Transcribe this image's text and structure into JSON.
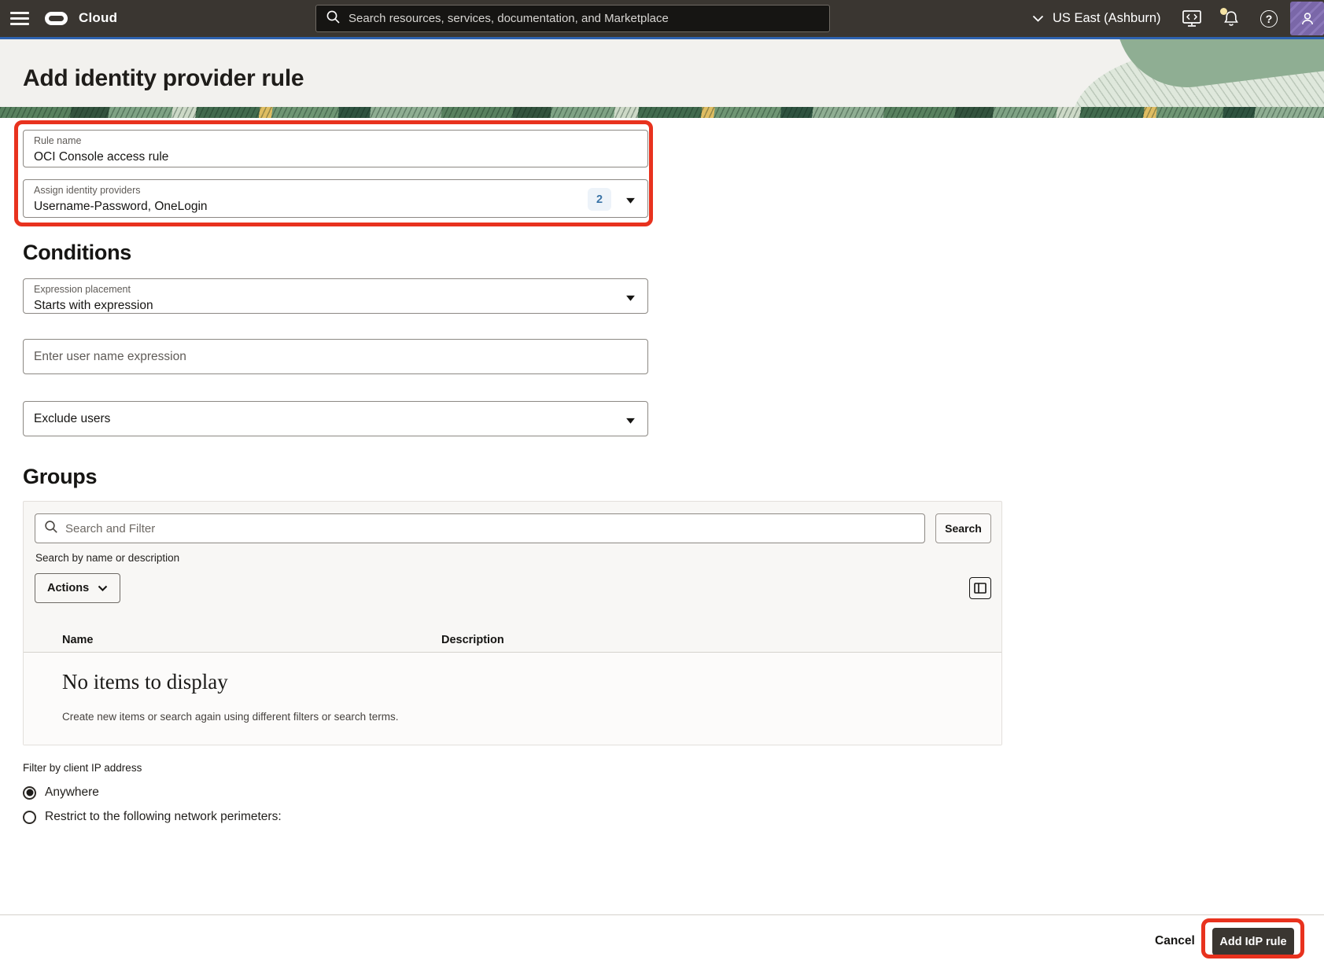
{
  "header": {
    "brand": "Cloud",
    "search_placeholder": "Search resources, services, documentation, and Marketplace",
    "region": "US East (Ashburn)",
    "help_glyph": "?"
  },
  "page": {
    "title": "Add identity provider rule"
  },
  "form": {
    "rule_name": {
      "label": "Rule name",
      "value": "OCI Console access rule"
    },
    "assign_idp": {
      "label": "Assign identity providers",
      "value": "Username-Password, OneLogin",
      "count_badge": "2"
    },
    "conditions_heading": "Conditions",
    "expression_placement": {
      "label": "Expression placement",
      "value": "Starts with expression"
    },
    "username_expression_placeholder": "Enter user name expression",
    "exclude_users_label": "Exclude users"
  },
  "groups": {
    "heading": "Groups",
    "search_placeholder": "Search and Filter",
    "search_button": "Search",
    "search_hint": "Search by name or description",
    "actions_button": "Actions",
    "table": {
      "columns": [
        "Name",
        "Description"
      ]
    },
    "empty_title": "No items to display",
    "empty_subtitle": "Create new items or search again using different filters or search terms."
  },
  "ip_filter": {
    "label": "Filter by client IP address",
    "options": [
      {
        "label": "Anywhere",
        "selected": true
      },
      {
        "label": "Restrict to the following network perimeters:",
        "selected": false
      }
    ]
  },
  "footer": {
    "cancel": "Cancel",
    "submit": "Add IdP rule"
  },
  "colors": {
    "topbar_bg": "#3a3631",
    "accent_blue": "#2d62b0",
    "annotation_red": "#e8321e",
    "badge_bg": "#edf3f9",
    "badge_text": "#3973a6",
    "banner_bg": "#f2f1ee",
    "panel_bg": "#f8f7f5"
  }
}
